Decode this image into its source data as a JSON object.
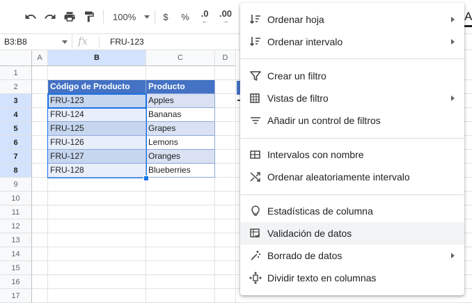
{
  "toolbar": {
    "zoom": "100%",
    "currency": "$",
    "percent": "%",
    "dec_decrease": ".0",
    "dec_increase": ".00",
    "text_color_letter": "A"
  },
  "formula_bar": {
    "name_box": "B3:B8",
    "fx": "fx",
    "value": "FRU-123"
  },
  "columns": [
    "A",
    "B",
    "C",
    "D"
  ],
  "rows": [
    "1",
    "2",
    "3",
    "4",
    "5",
    "6",
    "7",
    "8",
    "9",
    "10",
    "11",
    "12",
    "13",
    "14",
    "15",
    "16",
    "17"
  ],
  "table": {
    "headers": [
      "Código de Producto",
      "Producto"
    ],
    "rows": [
      [
        "FRU-123",
        "Apples"
      ],
      [
        "FRU-124",
        "Bananas"
      ],
      [
        "FRU-125",
        "Grapes"
      ],
      [
        "FRU-126",
        "Lemons"
      ],
      [
        "FRU-127",
        "Oranges"
      ],
      [
        "FRU-128",
        "Blueberries"
      ]
    ]
  },
  "menu": {
    "items": [
      {
        "label": "Ordenar hoja",
        "icon": "sort-icon",
        "submenu": true
      },
      {
        "label": "Ordenar intervalo",
        "icon": "sort-range-icon",
        "submenu": true
      },
      {
        "label": "Crear un filtro",
        "icon": "filter-icon",
        "submenu": false
      },
      {
        "label": "Vistas de filtro",
        "icon": "filter-views-icon",
        "submenu": true
      },
      {
        "label": "Añadir un control de filtros",
        "icon": "slicer-icon",
        "submenu": false
      },
      {
        "label": "Intervalos con nombre",
        "icon": "named-range-icon",
        "submenu": false
      },
      {
        "label": "Ordenar aleatoriamente intervalo",
        "icon": "shuffle-icon",
        "submenu": false
      },
      {
        "label": "Estadísticas de columna",
        "icon": "lightbulb-icon",
        "submenu": false
      },
      {
        "label": "Validación de datos",
        "icon": "data-validation-icon",
        "submenu": false
      },
      {
        "label": "Borrado de datos",
        "icon": "magic-wand-icon",
        "submenu": true
      },
      {
        "label": "Dividir texto en columnas",
        "icon": "split-columns-icon",
        "submenu": false
      }
    ]
  },
  "colors": {
    "header_blue": "#4472c4",
    "band_light": "#d9e1f2",
    "selection": "#1a73e8"
  }
}
